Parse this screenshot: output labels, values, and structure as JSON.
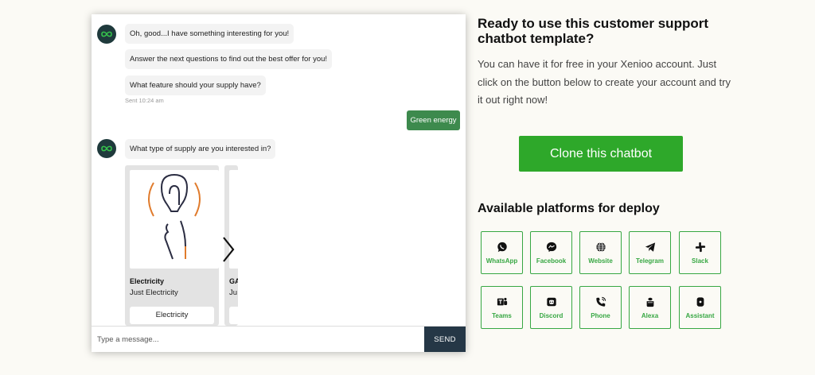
{
  "chat": {
    "messages": [
      "Oh, good...I have something interesting for you!",
      "Answer the next questions to find out the best offer for you!",
      "What feature should your supply have?"
    ],
    "sent_time": "Sent 10:24 am",
    "user_reply": "Green energy",
    "question": "What type of supply are you interested in?",
    "cards": [
      {
        "title": "Electricity",
        "subtitle": "Just Electricity",
        "button": "Electricity"
      },
      {
        "title": "GA",
        "subtitle": "Ju",
        "button": ""
      }
    ],
    "input_placeholder": "Type a message...",
    "send_label": "SEND"
  },
  "panel": {
    "heading": "Ready to use this customer support chatbot template?",
    "description": "You can have it for free in your Xenioo account. Just click on the button below to create your account and try it out right now!",
    "clone_label": "Clone this chatbot",
    "platforms_title": "Available platforms for deploy",
    "platforms": [
      {
        "label": "WhatsApp",
        "icon": "whatsapp-icon"
      },
      {
        "label": "Facebook",
        "icon": "messenger-icon"
      },
      {
        "label": "Website",
        "icon": "globe-icon"
      },
      {
        "label": "Telegram",
        "icon": "telegram-icon"
      },
      {
        "label": "Slack",
        "icon": "slack-icon"
      },
      {
        "label": "Teams",
        "icon": "teams-icon"
      },
      {
        "label": "Discord",
        "icon": "discord-icon"
      },
      {
        "label": "Phone",
        "icon": "phone-icon"
      },
      {
        "label": "Alexa",
        "icon": "alexa-icon"
      },
      {
        "label": "Assistant",
        "icon": "assistant-icon"
      }
    ]
  },
  "colors": {
    "accent_green": "#2ea82a",
    "platform_green": "#37a743",
    "user_bubble": "#3d8a4d",
    "send_button": "#253746",
    "avatar": "#1f3a3c",
    "electricity_orange": "#e07b2c"
  }
}
